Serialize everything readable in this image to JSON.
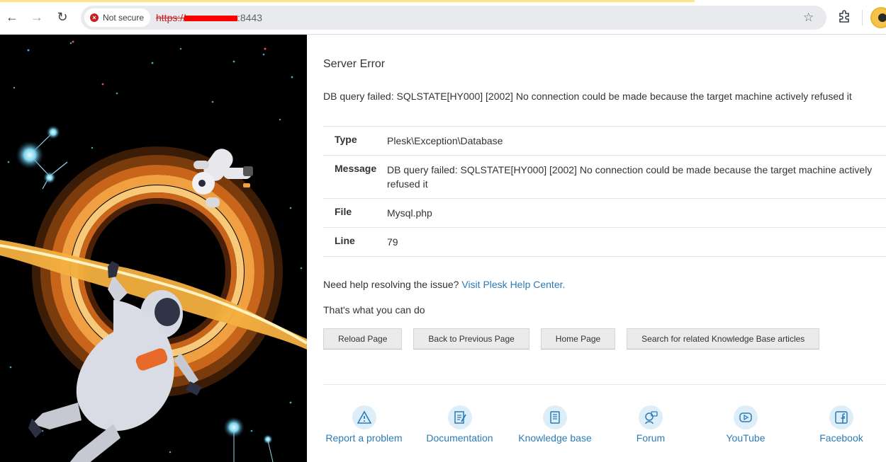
{
  "browser": {
    "security_chip": "Not secure",
    "url_scheme": "https://",
    "url_port": ":8443"
  },
  "page": {
    "title": "Server Error",
    "error_message": "DB query failed: SQLSTATE[HY000] [2002] No connection could be made because the target machine actively refused it",
    "details": [
      {
        "key": "Type",
        "value": "Plesk\\Exception\\Database"
      },
      {
        "key": "Message",
        "value": "DB query failed: SQLSTATE[HY000] [2002] No connection could be made because the target machine actively refused it"
      },
      {
        "key": "File",
        "value": "Mysql.php"
      },
      {
        "key": "Line",
        "value": "79"
      }
    ],
    "help_prefix": "Need help resolving the issue?",
    "help_link": "Visit Plesk Help Center.",
    "cando": "That's what you can do",
    "actions": [
      "Reload Page",
      "Back to Previous Page",
      "Home Page",
      "Search for related Knowledge Base articles"
    ],
    "links": [
      {
        "label": "Report a problem",
        "icon": "warning-icon"
      },
      {
        "label": "Documentation",
        "icon": "document-edit-icon"
      },
      {
        "label": "Knowledge base",
        "icon": "book-icon"
      },
      {
        "label": "Forum",
        "icon": "forum-icon"
      },
      {
        "label": "YouTube",
        "icon": "youtube-icon"
      },
      {
        "label": "Facebook",
        "icon": "facebook-icon"
      }
    ]
  },
  "colors": {
    "link": "#2c7bb6",
    "illustration_bg": "#000000",
    "portal": "#e07a1f"
  }
}
